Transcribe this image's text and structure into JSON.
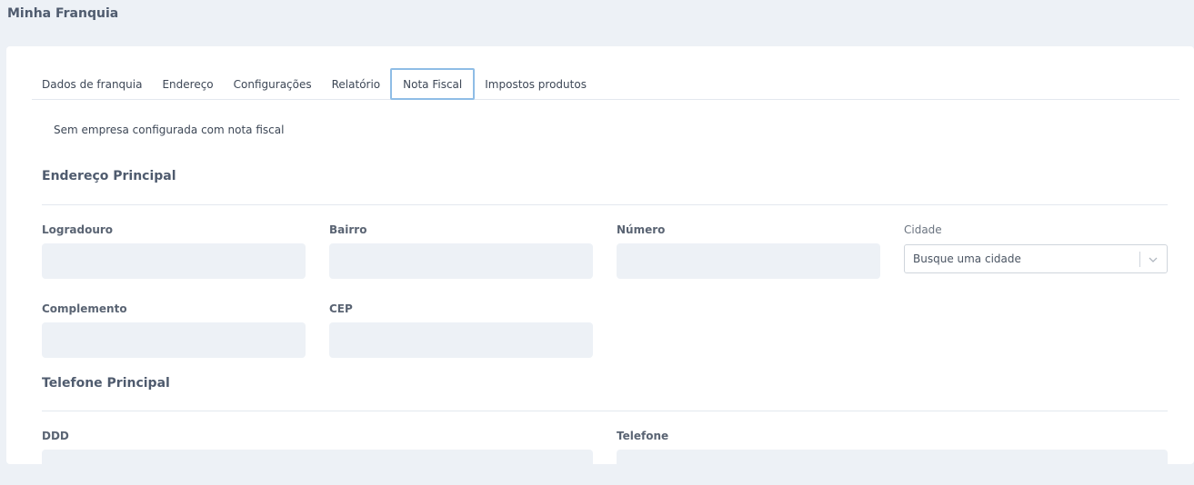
{
  "header": {
    "title": "Minha Franquia"
  },
  "tabs": [
    {
      "label": "Dados de franquia",
      "active": false
    },
    {
      "label": "Endereço",
      "active": false
    },
    {
      "label": "Configurações",
      "active": false
    },
    {
      "label": "Relatório",
      "active": false
    },
    {
      "label": "Nota Fiscal",
      "active": true
    },
    {
      "label": "Impostos produtos",
      "active": false
    }
  ],
  "notice": "Sem empresa configurada com nota fiscal",
  "address": {
    "title": "Endereço Principal",
    "logradouro": {
      "label": "Logradouro",
      "value": ""
    },
    "bairro": {
      "label": "Bairro",
      "value": ""
    },
    "numero": {
      "label": "Número",
      "value": ""
    },
    "cidade": {
      "label": "Cidade",
      "placeholder": "Busque uma cidade"
    },
    "complemento": {
      "label": "Complemento",
      "value": ""
    },
    "cep": {
      "label": "CEP",
      "value": ""
    }
  },
  "phone": {
    "title": "Telefone Principal",
    "ddd": {
      "label": "DDD",
      "value": ""
    },
    "telefone": {
      "label": "Telefone",
      "value": ""
    }
  },
  "colors": {
    "background": "#edf1f6",
    "card": "#ffffff",
    "active_tab_border": "#8fbde6",
    "field_fill": "#edf1f6"
  }
}
